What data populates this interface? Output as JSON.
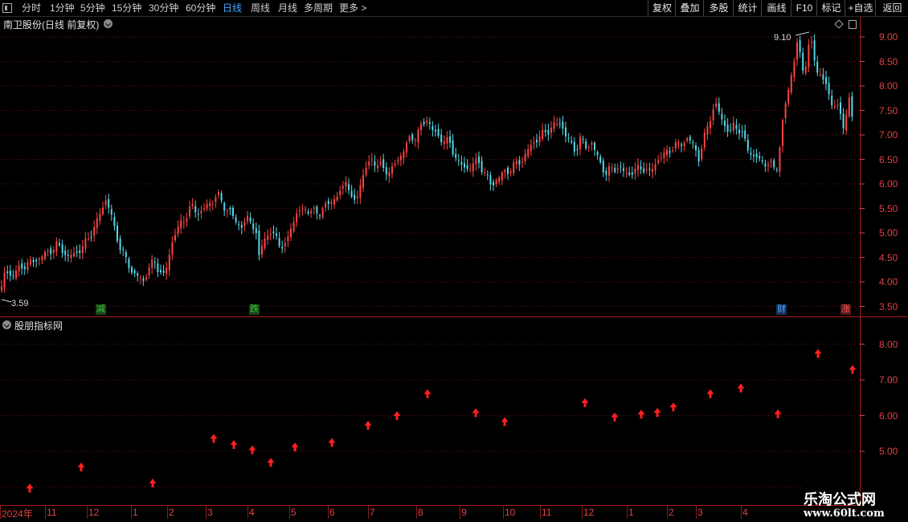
{
  "toolbar": {
    "periods": [
      "分时",
      "1分钟",
      "5分钟",
      "15分钟",
      "30分钟",
      "60分钟",
      "日线",
      "周线",
      "月线",
      "多周期",
      "更多 >"
    ],
    "active_period": "日线",
    "right_buttons": [
      "复权",
      "叠加",
      "多股",
      "统计",
      "画线",
      "F10",
      "标记",
      "+自选",
      "返回"
    ]
  },
  "stock_title": "南卫股份(日线 前复权)",
  "indicator_title": "股朋指标网",
  "price_labels": {
    "high": "9.10",
    "low": "3.59"
  },
  "badges": [
    {
      "text": "减",
      "color": "#3ac43a",
      "bg": "#184418"
    },
    {
      "text": "跌",
      "color": "#3ac43a",
      "bg": "#184418"
    },
    {
      "text": "财",
      "color": "#4aa8ff",
      "bg": "#1a2f55"
    },
    {
      "text": "涨",
      "color": "#ff5a5a",
      "bg": "#551a1a"
    }
  ],
  "dates": [
    "2024年",
    "11",
    "12",
    "1",
    "2",
    "3",
    "4",
    "5",
    "6",
    "7",
    "8",
    "9",
    "10",
    "11",
    "12",
    "1",
    "2",
    "3",
    "4"
  ],
  "y_main": [
    "9.00",
    "8.50",
    "8.00",
    "7.50",
    "7.00",
    "6.50",
    "6.00",
    "5.50",
    "5.00",
    "4.50",
    "4.00",
    "3.50"
  ],
  "y_ind": [
    "8.00",
    "7.00",
    "6.00",
    "5.00"
  ],
  "watermark": {
    "line1": "乐淘公式网",
    "line2": "www.60lt.com"
  },
  "colors": {
    "up": "#ff4444",
    "down": "#54d8e8",
    "accent": "#4aa8ff",
    "axis": "#aa1a1a",
    "grid": "#6b1515"
  },
  "chart_data": [
    {
      "type": "candlestick",
      "title": "南卫股份(日线 前复权)",
      "ylim": [
        3.4,
        9.2
      ],
      "x_ticks": [
        "2024年",
        "11",
        "12",
        "1",
        "2",
        "3",
        "4",
        "5",
        "6",
        "7",
        "8",
        "9",
        "10",
        "11",
        "12",
        "1",
        "2",
        "3",
        "4"
      ],
      "close_path": [
        [
          0,
          3.7
        ],
        [
          6,
          4.2
        ],
        [
          12,
          4.15
        ],
        [
          20,
          4.2
        ],
        [
          30,
          4.35
        ],
        [
          40,
          4.4
        ],
        [
          50,
          4.5
        ],
        [
          60,
          4.6
        ],
        [
          70,
          4.75
        ],
        [
          78,
          4.65
        ],
        [
          85,
          4.5
        ],
        [
          95,
          4.6
        ],
        [
          105,
          4.75
        ],
        [
          112,
          4.95
        ],
        [
          120,
          5.2
        ],
        [
          127,
          5.5
        ],
        [
          132,
          5.7
        ],
        [
          137,
          5.45
        ],
        [
          142,
          5.1
        ],
        [
          150,
          4.7
        ],
        [
          158,
          4.4
        ],
        [
          165,
          4.2
        ],
        [
          172,
          4.1
        ],
        [
          178,
          4.0
        ],
        [
          185,
          4.3
        ],
        [
          192,
          4.4
        ],
        [
          198,
          4.25
        ],
        [
          205,
          4.1
        ],
        [
          210,
          4.5
        ],
        [
          216,
          4.95
        ],
        [
          222,
          5.1
        ],
        [
          230,
          5.3
        ],
        [
          238,
          5.55
        ],
        [
          246,
          5.4
        ],
        [
          254,
          5.5
        ],
        [
          262,
          5.6
        ],
        [
          270,
          5.8
        ],
        [
          278,
          5.55
        ],
        [
          286,
          5.45
        ],
        [
          294,
          5.2
        ],
        [
          302,
          5.15
        ],
        [
          310,
          5.3
        ],
        [
          318,
          5.1
        ],
        [
          322,
          4.45
        ],
        [
          328,
          4.9
        ],
        [
          336,
          5.0
        ],
        [
          344,
          4.9
        ],
        [
          350,
          4.75
        ],
        [
          356,
          4.7
        ],
        [
          362,
          5.15
        ],
        [
          370,
          5.4
        ],
        [
          378,
          5.5
        ],
        [
          386,
          5.45
        ],
        [
          394,
          5.4
        ],
        [
          402,
          5.5
        ],
        [
          410,
          5.6
        ],
        [
          418,
          5.75
        ],
        [
          426,
          5.85
        ],
        [
          432,
          6.2
        ],
        [
          436,
          5.7
        ],
        [
          442,
          5.6
        ],
        [
          448,
          6.0
        ],
        [
          455,
          6.3
        ],
        [
          462,
          6.5
        ],
        [
          470,
          6.4
        ],
        [
          478,
          6.3
        ],
        [
          486,
          6.25
        ],
        [
          494,
          6.45
        ],
        [
          502,
          6.7
        ],
        [
          510,
          6.9
        ],
        [
          518,
          7.0
        ],
        [
          526,
          7.2
        ],
        [
          532,
          7.35
        ],
        [
          538,
          7.1
        ],
        [
          546,
          6.95
        ],
        [
          554,
          6.9
        ],
        [
          560,
          6.8
        ],
        [
          566,
          6.6
        ],
        [
          572,
          6.4
        ],
        [
          580,
          6.3
        ],
        [
          588,
          6.4
        ],
        [
          596,
          6.45
        ],
        [
          604,
          6.2
        ],
        [
          612,
          5.95
        ],
        [
          618,
          6.1
        ],
        [
          626,
          6.2
        ],
        [
          634,
          6.3
        ],
        [
          642,
          6.4
        ],
        [
          650,
          6.5
        ],
        [
          658,
          6.7
        ],
        [
          666,
          6.9
        ],
        [
          674,
          7.0
        ],
        [
          682,
          7.1
        ],
        [
          690,
          7.2
        ],
        [
          698,
          7.25
        ],
        [
          704,
          7.0
        ],
        [
          710,
          6.8
        ],
        [
          716,
          6.7
        ],
        [
          722,
          6.9
        ],
        [
          730,
          6.75
        ],
        [
          736,
          6.85
        ],
        [
          742,
          6.6
        ],
        [
          748,
          6.4
        ],
        [
          754,
          6.2
        ],
        [
          760,
          6.3
        ],
        [
          768,
          6.35
        ],
        [
          776,
          6.25
        ],
        [
          784,
          6.2
        ],
        [
          792,
          6.3
        ],
        [
          800,
          6.35
        ],
        [
          808,
          6.2
        ],
        [
          816,
          6.45
        ],
        [
          824,
          6.55
        ],
        [
          832,
          6.7
        ],
        [
          840,
          6.75
        ],
        [
          848,
          6.85
        ],
        [
          856,
          6.9
        ],
        [
          864,
          6.8
        ],
        [
          870,
          6.5
        ],
        [
          876,
          6.9
        ],
        [
          882,
          7.3
        ],
        [
          890,
          7.6
        ],
        [
          896,
          7.45
        ],
        [
          902,
          7.2
        ],
        [
          908,
          7.0
        ],
        [
          914,
          7.25
        ],
        [
          920,
          7.1
        ],
        [
          926,
          6.9
        ],
        [
          932,
          6.7
        ],
        [
          938,
          6.55
        ],
        [
          944,
          6.5
        ],
        [
          950,
          6.45
        ],
        [
          956,
          6.4
        ],
        [
          962,
          6.35
        ],
        [
          966,
          6.3
        ],
        [
          970,
          6.7
        ],
        [
          976,
          7.5
        ],
        [
          982,
          8.0
        ],
        [
          988,
          8.5
        ],
        [
          992,
          8.85
        ],
        [
          996,
          8.6
        ],
        [
          1000,
          8.3
        ],
        [
          1004,
          8.55
        ],
        [
          1008,
          8.95
        ],
        [
          1012,
          8.7
        ],
        [
          1016,
          8.35
        ],
        [
          1022,
          8.2
        ],
        [
          1028,
          8.0
        ],
        [
          1034,
          7.7
        ],
        [
          1040,
          7.6
        ],
        [
          1046,
          7.4
        ],
        [
          1050,
          7.2
        ],
        [
          1054,
          7.5
        ],
        [
          1058,
          7.8
        ],
        [
          1062,
          7.05
        ]
      ]
    },
    {
      "type": "scatter",
      "title": "股朋指标网",
      "marker": "up-arrow",
      "ylim": [
        4.0,
        8.6
      ],
      "points": [
        [
          37,
          3.96
        ],
        [
          101,
          4.55
        ],
        [
          190,
          4.1
        ],
        [
          266,
          5.35
        ],
        [
          291,
          5.18
        ],
        [
          314,
          5.03
        ],
        [
          337,
          4.68
        ],
        [
          367,
          5.11
        ],
        [
          413,
          5.24
        ],
        [
          458,
          5.72
        ],
        [
          494,
          5.99
        ],
        [
          532,
          6.6
        ],
        [
          592,
          6.07
        ],
        [
          628,
          5.82
        ],
        [
          728,
          6.35
        ],
        [
          765,
          5.95
        ],
        [
          798,
          6.03
        ],
        [
          818,
          6.08
        ],
        [
          838,
          6.23
        ],
        [
          884,
          6.6
        ],
        [
          922,
          6.76
        ],
        [
          968,
          6.04
        ],
        [
          1018,
          7.73
        ],
        [
          1061,
          7.28
        ]
      ]
    }
  ]
}
